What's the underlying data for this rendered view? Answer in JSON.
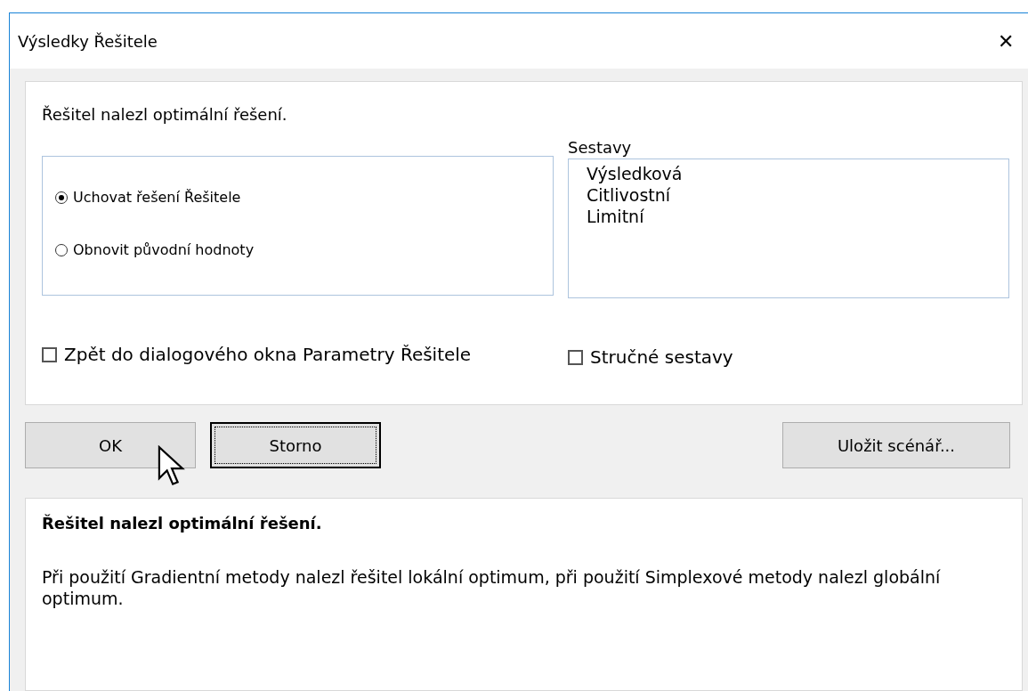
{
  "window": {
    "title": "Výsledky Řešitele",
    "close": "✕"
  },
  "message": "Řešitel nalezl optimální řešení.",
  "options": [
    {
      "label": "Uchovat řešení Řešitele",
      "selected": true
    },
    {
      "label": "Obnovit původní hodnoty",
      "selected": false
    }
  ],
  "reports": {
    "label": "Sestavy",
    "items": [
      {
        "label": "Výsledková",
        "selected": false
      },
      {
        "label": "Citlivostní",
        "selected": false
      },
      {
        "label": "Limitní",
        "selected": false
      }
    ]
  },
  "checkboxes": [
    {
      "label": "Zpět do dialogového okna Parametry Řešitele",
      "checked": false
    },
    {
      "label": "Stručné sestavy",
      "checked": false
    }
  ],
  "buttons": [
    {
      "label": "OK",
      "focused": false
    },
    {
      "label": "Storno",
      "focused": true
    }
  ],
  "side_buttons": [
    {
      "label": "Uložit scénář...",
      "focused": false
    }
  ],
  "description": {
    "title": "Řešitel nalezl optimální řešení.",
    "text": "Při použití Gradientní metody nalezl řešitel lokální optimum, při použití Simplexové metody nalezl globální optimum."
  }
}
